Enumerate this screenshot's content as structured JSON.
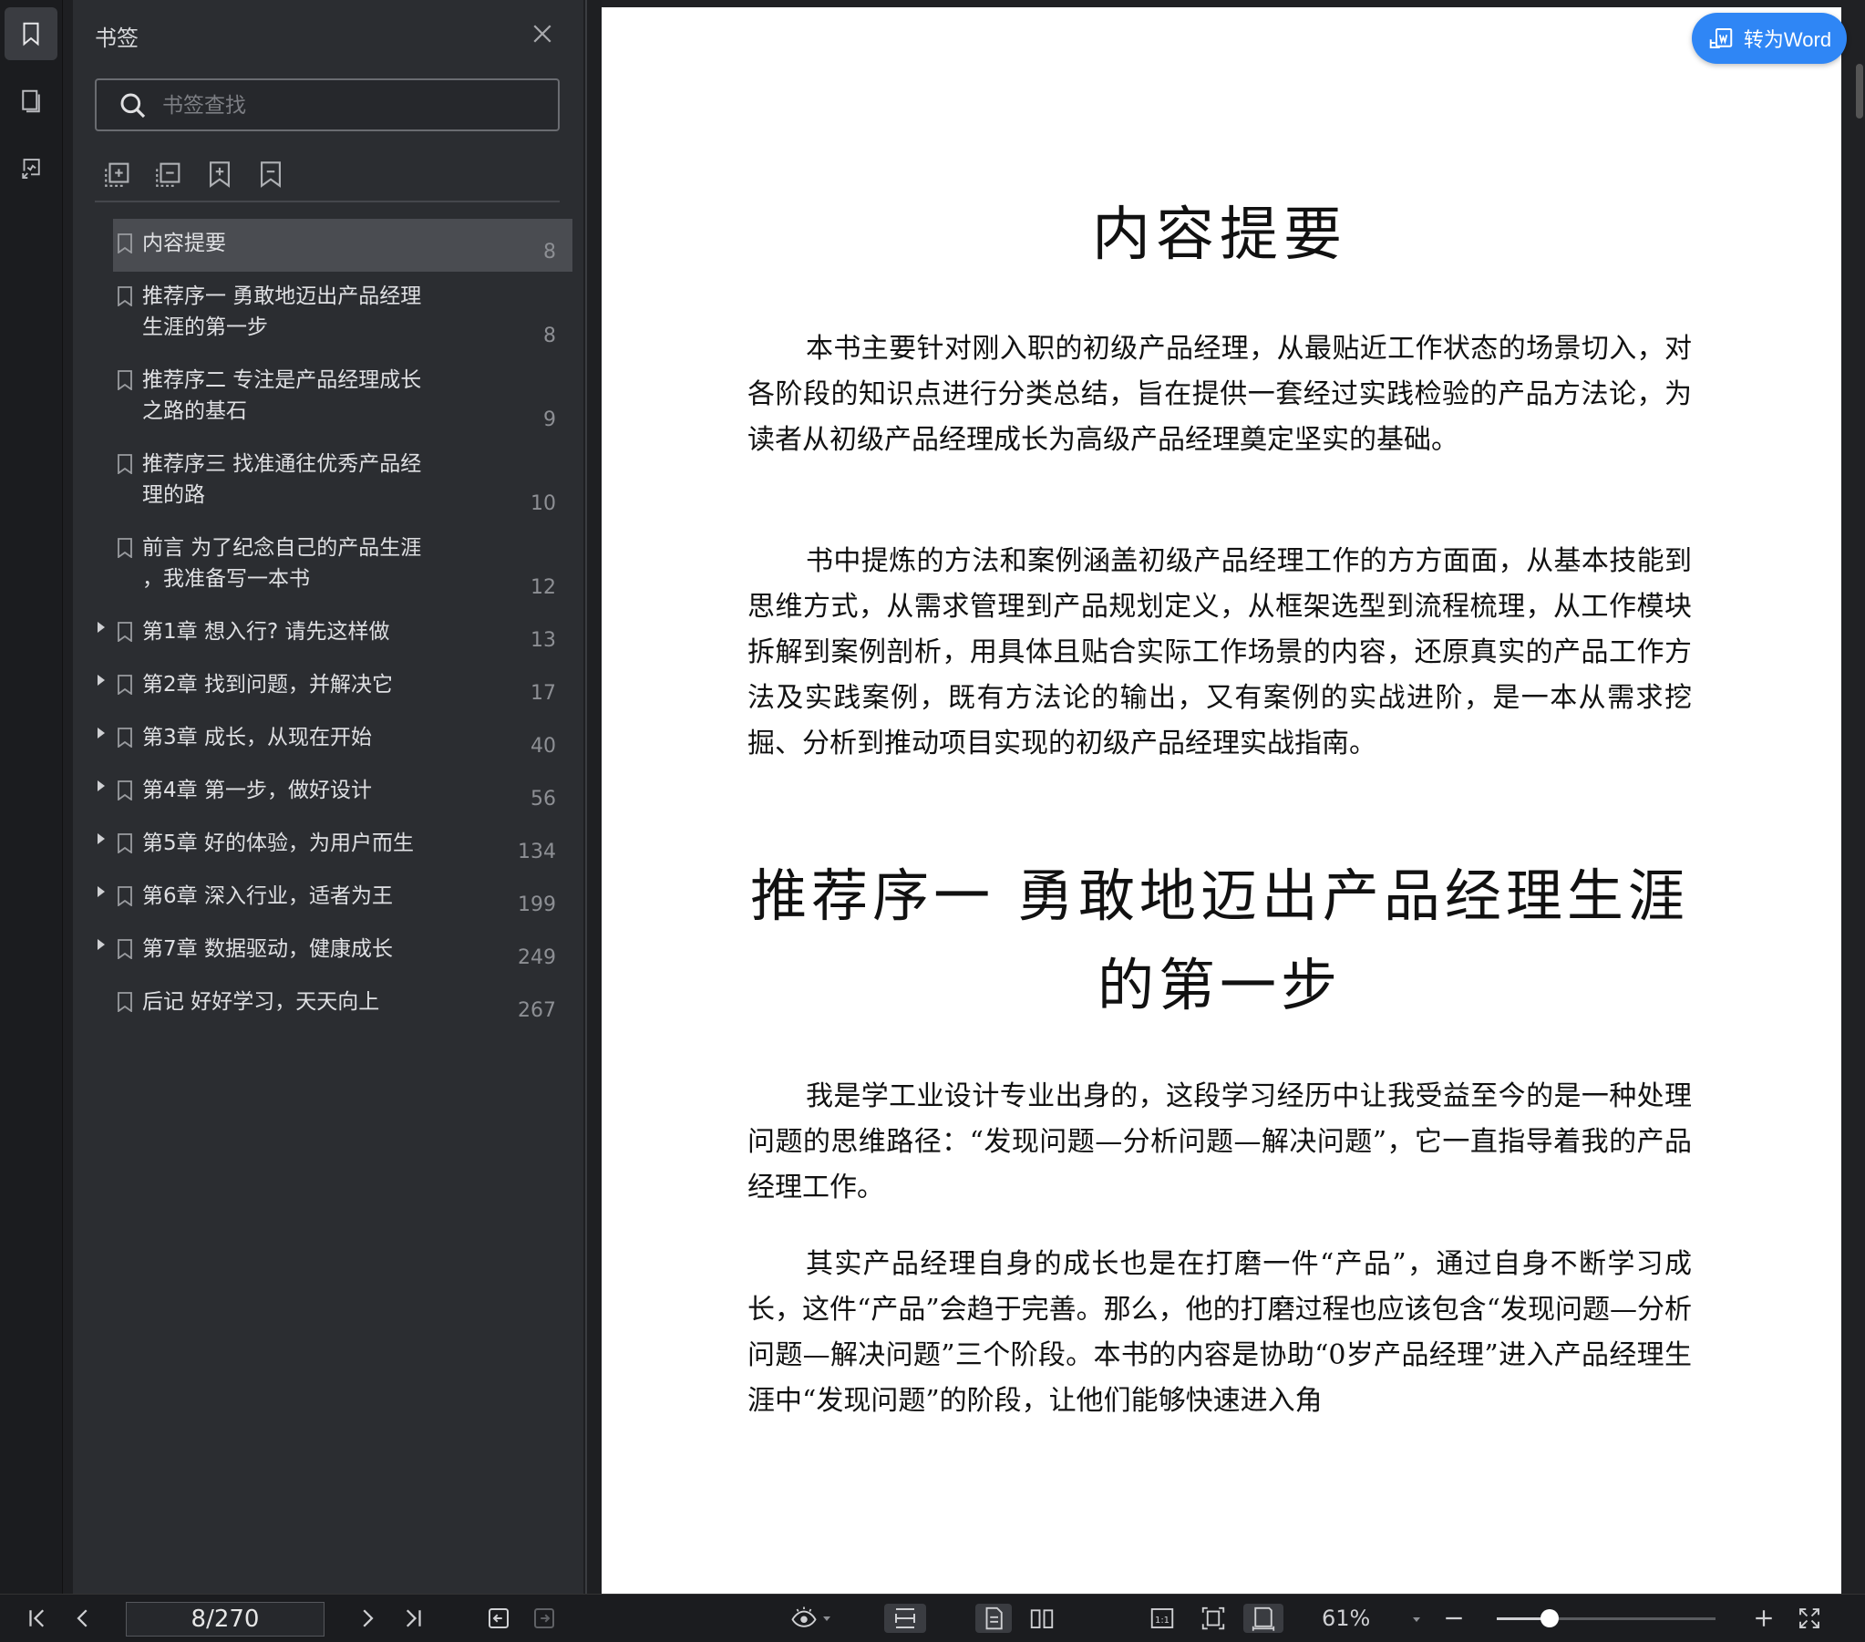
{
  "sidebar": {
    "title": "书签",
    "search": {
      "placeholder": "书签查找"
    },
    "bookmarks": [
      {
        "label": "内容提要",
        "page": "8",
        "expandable": false,
        "selected": true
      },
      {
        "label": "推荐序一 勇敢地迈出产品经理\n生涯的第一步",
        "page": "8",
        "expandable": false
      },
      {
        "label": "推荐序二 专注是产品经理成长\n之路的基石",
        "page": "9",
        "expandable": false
      },
      {
        "label": "推荐序三 找准通往优秀产品经\n理的路",
        "page": "10",
        "expandable": false
      },
      {
        "label": "前言 为了纪念自己的产品生涯\n，我准备写一本书",
        "page": "12",
        "expandable": false
      },
      {
        "label": "第1章 想入行? 请先这样做",
        "page": "13",
        "expandable": true
      },
      {
        "label": "第2章 找到问题，并解决它",
        "page": "17",
        "expandable": true
      },
      {
        "label": "第3章 成长，从现在开始",
        "page": "40",
        "expandable": true
      },
      {
        "label": "第4章 第一步，做好设计",
        "page": "56",
        "expandable": true
      },
      {
        "label": "第5章 好的体验，为用户而生",
        "page": "134",
        "expandable": true
      },
      {
        "label": "第6章 深入行业，适者为王",
        "page": "199",
        "expandable": true
      },
      {
        "label": "第7章 数据驱动，健康成长",
        "page": "249",
        "expandable": true
      },
      {
        "label": "后记 好好学习，天天向上",
        "page": "267",
        "expandable": false
      }
    ]
  },
  "document": {
    "heading1": "内容提要",
    "para1": "本书主要针对刚入职的初级产品经理，从最贴近工作状态的场景切入，对各阶段的知识点进行分类总结，旨在提供一套经过实践检验的产品方法论，为读者从初级产品经理成长为高级产品经理奠定坚实的基础。",
    "para2": "书中提炼的方法和案例涵盖初级产品经理工作的方方面面，从基本技能到思维方式，从需求管理到产品规划定义，从框架选型到流程梳理，从工作模块拆解到案例剖析，用具体且贴合实际工作场景的内容，还原真实的产品工作方法及实践案例，既有方法论的输出，又有案例的实战进阶，是一本从需求挖掘、分析到推动项目实现的初级产品经理实战指南。",
    "heading2": "推荐序一 勇敢地迈出产品经理生涯的第一步",
    "para3": "我是学工业设计专业出身的，这段学习经历中让我受益至今的是一种处理问题的思维路径：“发现问题—分析问题—解决问题”，它一直指导着我的产品经理工作。",
    "para4": "其实产品经理自身的成长也是在打磨一件“产品”，通过自身不断学习成长，这件“产品”会趋于完善。那么，他的打磨过程也应该包含“发现问题—分析问题—解决问题”三个阶段。本书的内容是协助“0岁产品经理”进入产品经理生涯中“发现问题”的阶段，让他们能够快速进入角"
  },
  "convert_button": {
    "label": "转为Word",
    "color": "#2f86f5"
  },
  "toolbar": {
    "page_indicator": "8/270",
    "zoom": "61%",
    "zoom_level": 0.24
  }
}
